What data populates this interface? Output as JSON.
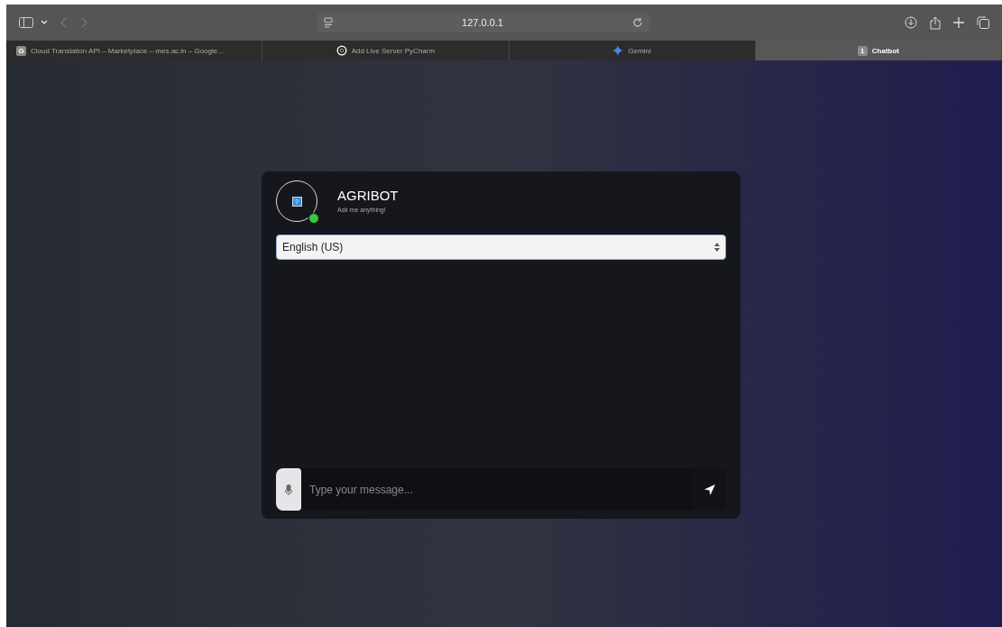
{
  "browser": {
    "address": "127.0.0.1"
  },
  "tabs": [
    {
      "label": "Cloud Translation API – Marketplace – mes.ac.in – Google...",
      "favicon": "G",
      "kind": "letter",
      "selected": false
    },
    {
      "label": "Add Live Server PyCharm",
      "kind": "round",
      "selected": false
    },
    {
      "label": "Gemini",
      "kind": "star",
      "selected": false
    },
    {
      "label": "Chatbot",
      "favicon": "1",
      "kind": "letter",
      "selected": true
    }
  ],
  "chat": {
    "title": "AGRIBOT",
    "subtitle": "Ask me anything!",
    "avatar_glyph": "?",
    "online": true,
    "language": "English (US)",
    "placeholder": "Type your message..."
  }
}
